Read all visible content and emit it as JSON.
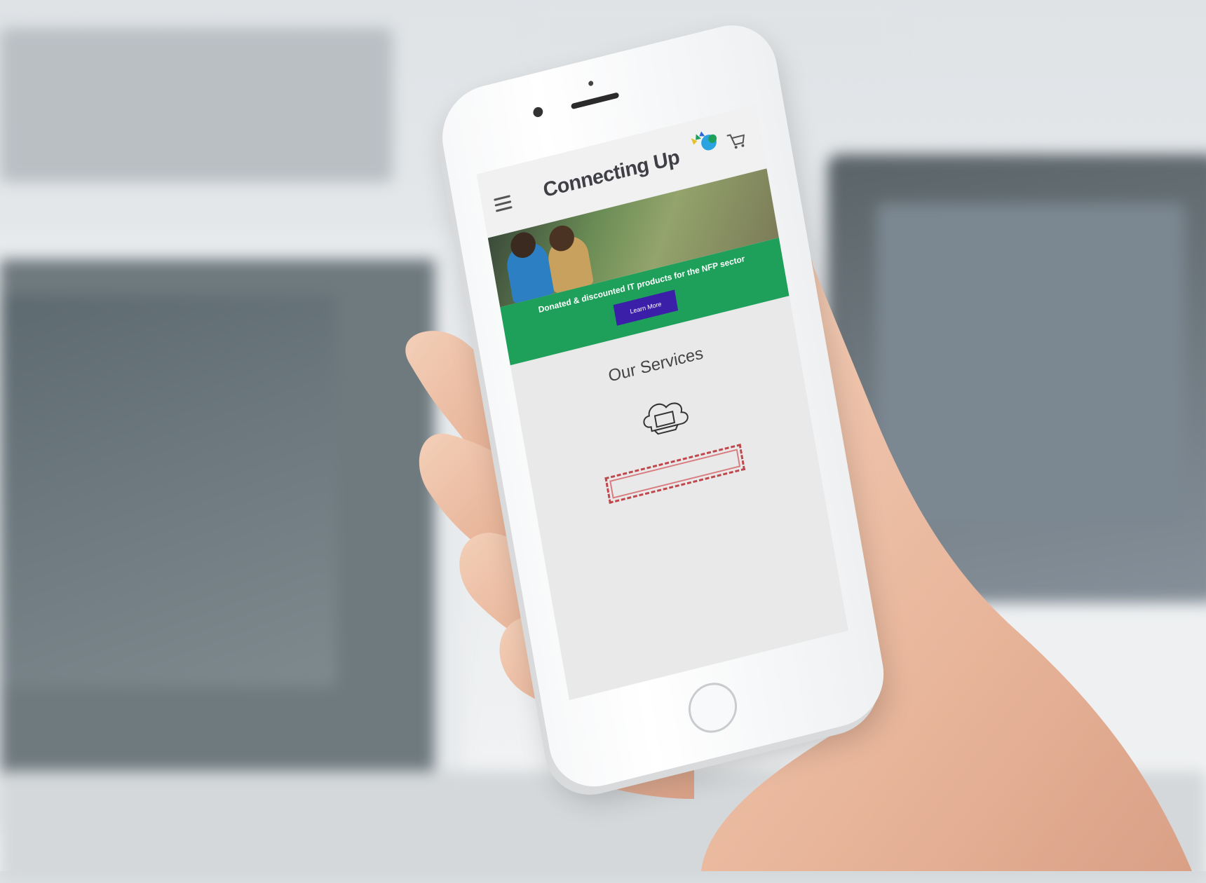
{
  "site": {
    "logo_text": "Connecting Up",
    "logo_tagline": "",
    "menu_icon": "hamburger-menu-icon",
    "cart_icon": "shopping-cart-icon"
  },
  "banner": {
    "title": "Donated & discounted IT products for the NFP sector",
    "text": "",
    "button_label": "Learn More"
  },
  "services": {
    "title": "Our Services",
    "icon": "cloud-technology-icon",
    "item_heading": "",
    "item_text": "",
    "item_button": ""
  },
  "colors": {
    "banner_green": "#1fa05a",
    "button_purple": "#3b1fa8",
    "logo_blue": "#2a6ad8",
    "outline_red": "#c0474b"
  }
}
